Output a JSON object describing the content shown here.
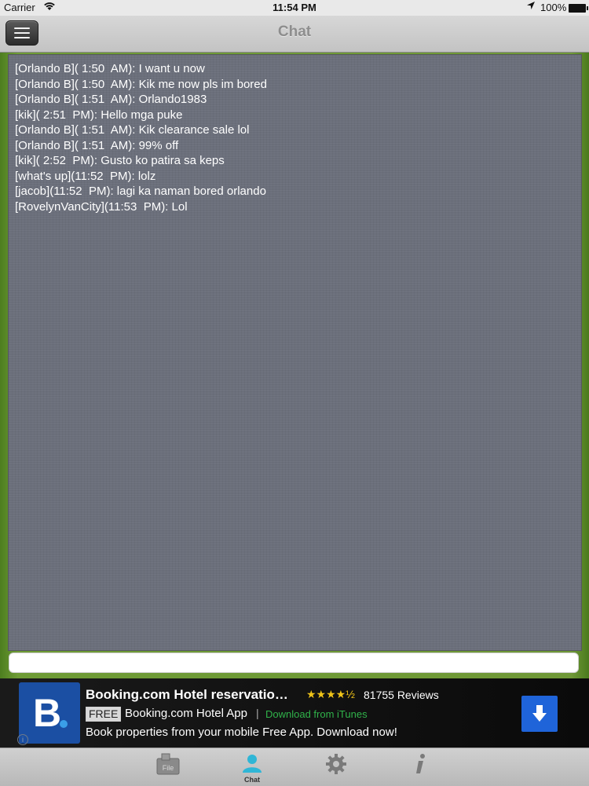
{
  "status_bar": {
    "carrier": "Carrier",
    "time": "11:54 PM",
    "battery": "100%"
  },
  "nav": {
    "title": "Chat",
    "menu_icon": "hamburger-menu-icon"
  },
  "chat": {
    "messages": [
      "[Orlando B]( 1:50  AM): I want u now",
      "[Orlando B]( 1:50  AM): Kik me now pls im bored",
      "[Orlando B]( 1:51  AM): Orlando1983",
      "[kik]( 2:51  PM): Hello mga puke",
      "[Orlando B]( 1:51  AM): Kik clearance sale lol",
      "[Orlando B]( 1:51  AM): 99% off",
      "[kik]( 2:52  PM): Gusto ko patira sa keps",
      "[what's up](11:52  PM): lolz",
      "[jacob](11:52  PM): lagi ka naman bored orlando",
      "[RovelynVanCity](11:53  PM): Lol"
    ],
    "input_value": ""
  },
  "ad": {
    "logo_letter": "B.",
    "title": "Booking.com Hotel reservatio…",
    "rating_stars": "★★★★½",
    "rating": 4.5,
    "reviews": "81755 Reviews",
    "free_badge": "FREE",
    "app_name": "Booking.com Hotel App",
    "separator": "|",
    "download_link": "Download from iTunes",
    "description": "Book properties from your mobile Free App. Download now!",
    "info_icon": "i",
    "colors": {
      "logo_bg": "#1b4fa3",
      "button_bg": "#1f64d9",
      "link": "#30b34a"
    }
  },
  "tabs": [
    {
      "label": "",
      "icon": "file-icon"
    },
    {
      "label": "Chat",
      "icon": "chat-icon"
    },
    {
      "label": "",
      "icon": "settings-gear-icon"
    },
    {
      "label": "",
      "icon": "info-icon"
    }
  ]
}
